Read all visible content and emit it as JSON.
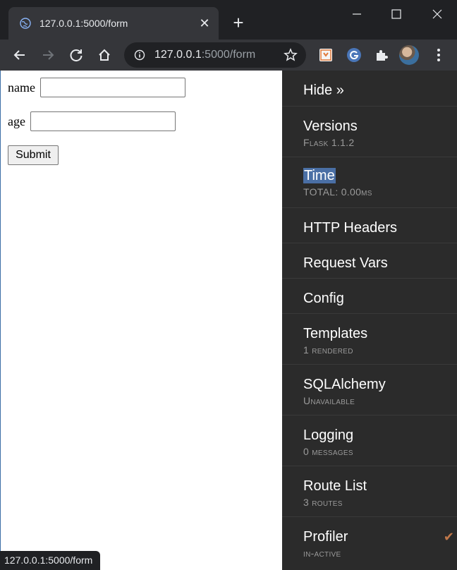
{
  "tab": {
    "title": "127.0.0.1:5000/form",
    "close": "✕"
  },
  "new_tab_label": "+",
  "omnibox": {
    "host": "127.0.0.1",
    "path": ":5000/form"
  },
  "form": {
    "name_label": "name",
    "name_value": "",
    "age_label": "age",
    "age_value": "",
    "submit_label": "Submit"
  },
  "debug_toolbar": {
    "hide_label": "Hide »",
    "panels": [
      {
        "title": "Versions",
        "subtitle": "Flask 1.1.2"
      },
      {
        "title": "Time",
        "subtitle": "TOTAL: 0.00ms"
      },
      {
        "title": "HTTP Headers",
        "subtitle": ""
      },
      {
        "title": "Request Vars",
        "subtitle": ""
      },
      {
        "title": "Config",
        "subtitle": ""
      },
      {
        "title": "Templates",
        "subtitle": "1 rendered"
      },
      {
        "title": "SQLAlchemy",
        "subtitle": "Unavailable"
      },
      {
        "title": "Logging",
        "subtitle": "0 messages"
      },
      {
        "title": "Route List",
        "subtitle": "3 routes"
      },
      {
        "title": "Profiler",
        "subtitle": "in-active",
        "check": "✔"
      }
    ]
  },
  "status_bar": {
    "url": "127.0.0.1:5000/form"
  },
  "icons": {
    "favicon": "globe-icon",
    "back": "back-arrow-icon",
    "forward": "forward-arrow-icon",
    "reload": "reload-icon",
    "home": "home-icon",
    "info": "info-icon",
    "star": "star-icon",
    "ext1": "extension-icon",
    "ext2": "google-g-icon",
    "puzzle": "puzzle-icon",
    "menu": "menu-dots-icon"
  },
  "colors": {
    "highlight": "#4a6fa5",
    "check": "#c0784a",
    "debug_bg": "#2b2b2b"
  }
}
